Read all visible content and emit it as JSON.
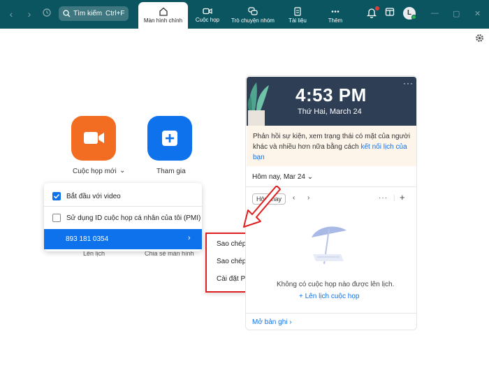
{
  "search": {
    "label": "Tìm kiếm",
    "shortcut": "Ctrl+F"
  },
  "tabs": [
    {
      "label": "Màn hình chính"
    },
    {
      "label": "Cuộc họp"
    },
    {
      "label": "Trò chuyện nhóm"
    },
    {
      "label": "Tài liệu"
    },
    {
      "label": "Thêm"
    }
  ],
  "avatar": {
    "initial": "L"
  },
  "actions": {
    "new_meeting": "Cuộc họp mới",
    "join": "Tham gia",
    "schedule_behind": "Lên lịch",
    "share_behind": "Chia sẻ màn hình"
  },
  "dropdown": {
    "start_with_video": "Bắt đầu với video",
    "use_pmi": "Sử dụng ID cuộc họp cá nhân của tôi (PMI)",
    "pmi_number": "893 181 0354"
  },
  "submenu": {
    "copy_id": "Sao chép ID",
    "copy_invite": "Sao chép lời mời",
    "pmi_settings": "Cài đặt PMI"
  },
  "clock": {
    "time": "4:53 PM",
    "date": "Thứ Hai, March 24"
  },
  "notice": {
    "text": "Phản hồi sự kiện, xem trạng thái có mặt của người khác và nhiều hơn nữa bằng cách",
    "link": "kết nối lịch của bạn"
  },
  "calendar": {
    "today_label": "Hôm nay, Mar 24",
    "today_button": "Hôm nay",
    "empty": "Không có cuộc họp nào được lên lịch.",
    "schedule_link": "Lên lịch cuộc họp",
    "recordings_link": "Mở bản ghi"
  },
  "colors": {
    "topbar": "#0b5560",
    "new_meeting": "#f26d21",
    "join": "#0e72ed",
    "highlight": "#e02020"
  }
}
